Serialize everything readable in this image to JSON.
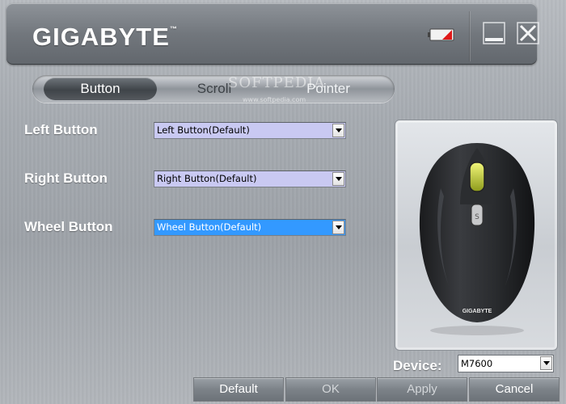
{
  "header": {
    "logo_text": "GIGABYTE",
    "logo_tm": "™",
    "battery_icon": "battery-low-icon",
    "minimize_icon": "minimize-icon",
    "close_icon": "close-icon"
  },
  "tabs": [
    {
      "label": "Button",
      "active": true
    },
    {
      "label": "Scroll",
      "active": false
    },
    {
      "label": "Pointer",
      "active": false
    }
  ],
  "watermark": {
    "text": "SOFTPEDIA",
    "sub": "www.softpedia.com"
  },
  "settings": [
    {
      "label": "Left Button",
      "value": "Left Button(Default)"
    },
    {
      "label": "Right Button",
      "value": "Right Button(Default)"
    },
    {
      "label": "Wheel Button",
      "value": "Wheel Button(Default)"
    }
  ],
  "preview": {
    "brand_on_mouse": "GIGABYTE"
  },
  "device": {
    "label": "Device:",
    "value": "M7600"
  },
  "footer": {
    "default_label": "Default",
    "ok_label": "OK",
    "apply_label": "Apply",
    "cancel_label": "Cancel"
  },
  "colors": {
    "selected_combo": "#3399ff",
    "combo_bg": "#c9c9f2",
    "battery_red": "#e01818"
  }
}
